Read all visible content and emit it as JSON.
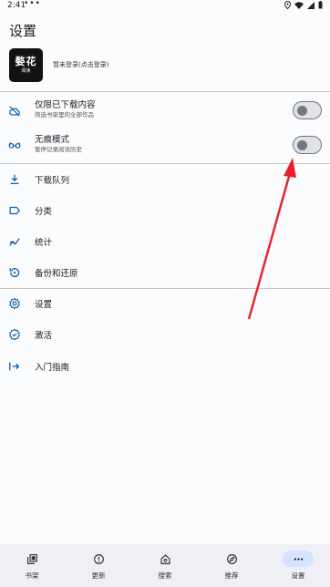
{
  "status_bar": {
    "time": "2:41",
    "dots": "•••"
  },
  "page": {
    "title": "设置"
  },
  "account": {
    "logo_line1": "婺花",
    "logo_line2": "阅读",
    "text": "暂未登录(点击登录)"
  },
  "toggles": [
    {
      "icon": "cloud-off-icon",
      "title": "仅限已下载内容",
      "subtitle": "筛选书架里的全部作品",
      "on": false
    },
    {
      "icon": "glasses-icon",
      "title": "无痕模式",
      "subtitle": "暂停记录阅读历史",
      "on": false
    }
  ],
  "menu": [
    {
      "icon": "download-icon",
      "label": "下载队列"
    },
    {
      "icon": "label-icon",
      "label": "分类"
    },
    {
      "icon": "stats-icon",
      "label": "统计"
    },
    {
      "icon": "restore-icon",
      "label": "备份和还原"
    },
    {
      "icon": "settings-icon",
      "label": "设置"
    },
    {
      "icon": "verified-icon",
      "label": "激活"
    },
    {
      "icon": "login-icon",
      "label": "入门指南"
    }
  ],
  "bottom_nav": [
    {
      "icon": "bookshelf-icon",
      "label": "书架"
    },
    {
      "icon": "update-icon",
      "label": "更新"
    },
    {
      "icon": "search-home-icon",
      "label": "搜索"
    },
    {
      "icon": "compass-icon",
      "label": "推荐"
    },
    {
      "icon": "more-icon",
      "label": "设置",
      "active": true
    }
  ],
  "colors": {
    "accent": "#0d5fa6",
    "annotation_arrow": "#e8202a",
    "active_pill": "#d6e3ff"
  }
}
